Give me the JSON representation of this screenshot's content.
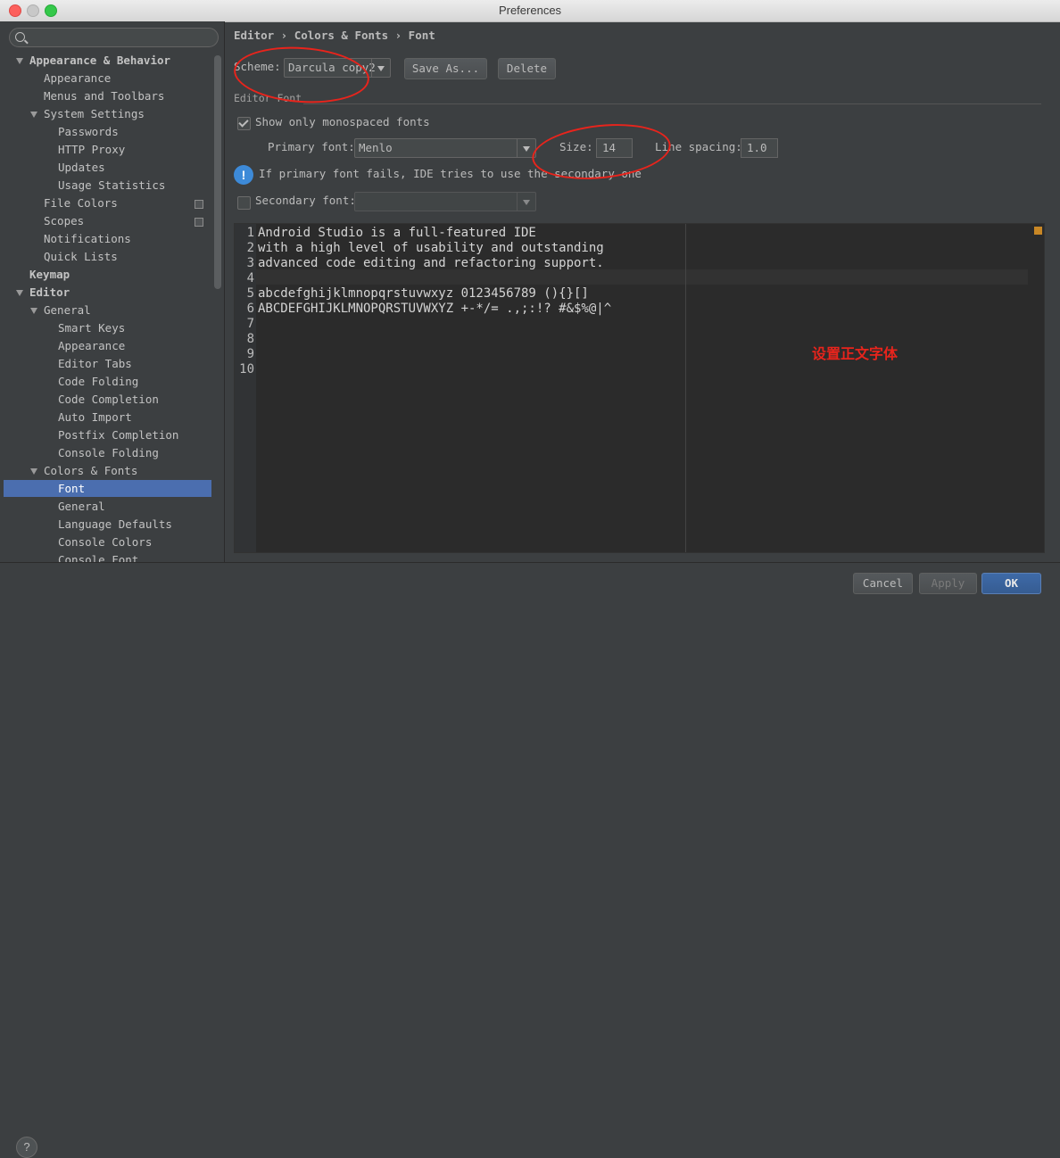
{
  "window": {
    "title": "Preferences"
  },
  "sidebar": {
    "items": [
      {
        "label": "Appearance & Behavior",
        "level": 0,
        "expanded": true,
        "bold": true
      },
      {
        "label": "Appearance",
        "level": 1
      },
      {
        "label": "Menus and Toolbars",
        "level": 1
      },
      {
        "label": "System Settings",
        "level": 1,
        "expanded": true
      },
      {
        "label": "Passwords",
        "level": 2
      },
      {
        "label": "HTTP Proxy",
        "level": 2
      },
      {
        "label": "Updates",
        "level": 2
      },
      {
        "label": "Usage Statistics",
        "level": 2
      },
      {
        "label": "File Colors",
        "level": 1,
        "icon": "copy-icon"
      },
      {
        "label": "Scopes",
        "level": 1,
        "icon": "copy-icon"
      },
      {
        "label": "Notifications",
        "level": 1
      },
      {
        "label": "Quick Lists",
        "level": 1
      },
      {
        "label": "Keymap",
        "level": 0,
        "bold": true
      },
      {
        "label": "Editor",
        "level": 0,
        "expanded": true,
        "bold": true
      },
      {
        "label": "General",
        "level": 1,
        "expanded": true
      },
      {
        "label": "Smart Keys",
        "level": 2
      },
      {
        "label": "Appearance",
        "level": 2
      },
      {
        "label": "Editor Tabs",
        "level": 2
      },
      {
        "label": "Code Folding",
        "level": 2
      },
      {
        "label": "Code Completion",
        "level": 2
      },
      {
        "label": "Auto Import",
        "level": 2
      },
      {
        "label": "Postfix Completion",
        "level": 2
      },
      {
        "label": "Console Folding",
        "level": 2
      },
      {
        "label": "Colors & Fonts",
        "level": 1,
        "expanded": true
      },
      {
        "label": "Font",
        "level": 2,
        "selected": true
      },
      {
        "label": "General",
        "level": 2
      },
      {
        "label": "Language Defaults",
        "level": 2
      },
      {
        "label": "Console Colors",
        "level": 2
      },
      {
        "label": "Console Font",
        "level": 2
      }
    ]
  },
  "breadcrumb": "Editor › Colors & Fonts › Font",
  "scheme": {
    "label": "Scheme:",
    "value": "Darcula copy2",
    "save_as": "Save As...",
    "delete": "Delete"
  },
  "editor_font": {
    "section": "Editor Font",
    "monospaced_label": "Show only monospaced fonts",
    "monospaced_checked": true,
    "primary_label": "Primary font:",
    "primary_value": "Menlo",
    "size_label": "Size:",
    "size_value": "14",
    "spacing_label": "Line spacing:",
    "spacing_value": "1.0",
    "info_text": "If primary font fails, IDE tries to use the secondary one",
    "secondary_label": "Secondary font:",
    "secondary_checked": false,
    "secondary_value": ""
  },
  "preview": {
    "lines": [
      {
        "n": "1",
        "text": "Android Studio is a full-featured IDE"
      },
      {
        "n": "2",
        "text": "with a high level of usability and outstanding"
      },
      {
        "n": "3",
        "text": "advanced code editing and refactoring support."
      },
      {
        "n": "4",
        "text": ""
      },
      {
        "n": "5",
        "text": "abcdefghijklmnopqrstuvwxyz 0123456789 (){}[]"
      },
      {
        "n": "6",
        "text": "ABCDEFGHIJKLMNOPQRSTUVWXYZ +-*/= .,;:!? #&$%@|^"
      },
      {
        "n": "7",
        "text": ""
      },
      {
        "n": "8",
        "text": ""
      },
      {
        "n": "9",
        "text": ""
      },
      {
        "n": "10",
        "text": ""
      }
    ]
  },
  "annotation": "设置正文字体",
  "footer": {
    "help": "?",
    "cancel": "Cancel",
    "apply": "Apply",
    "ok": "OK"
  },
  "colors": {
    "selection": "#4b6eaf",
    "annotation": "#e8241c",
    "background": "#3c3f41"
  }
}
